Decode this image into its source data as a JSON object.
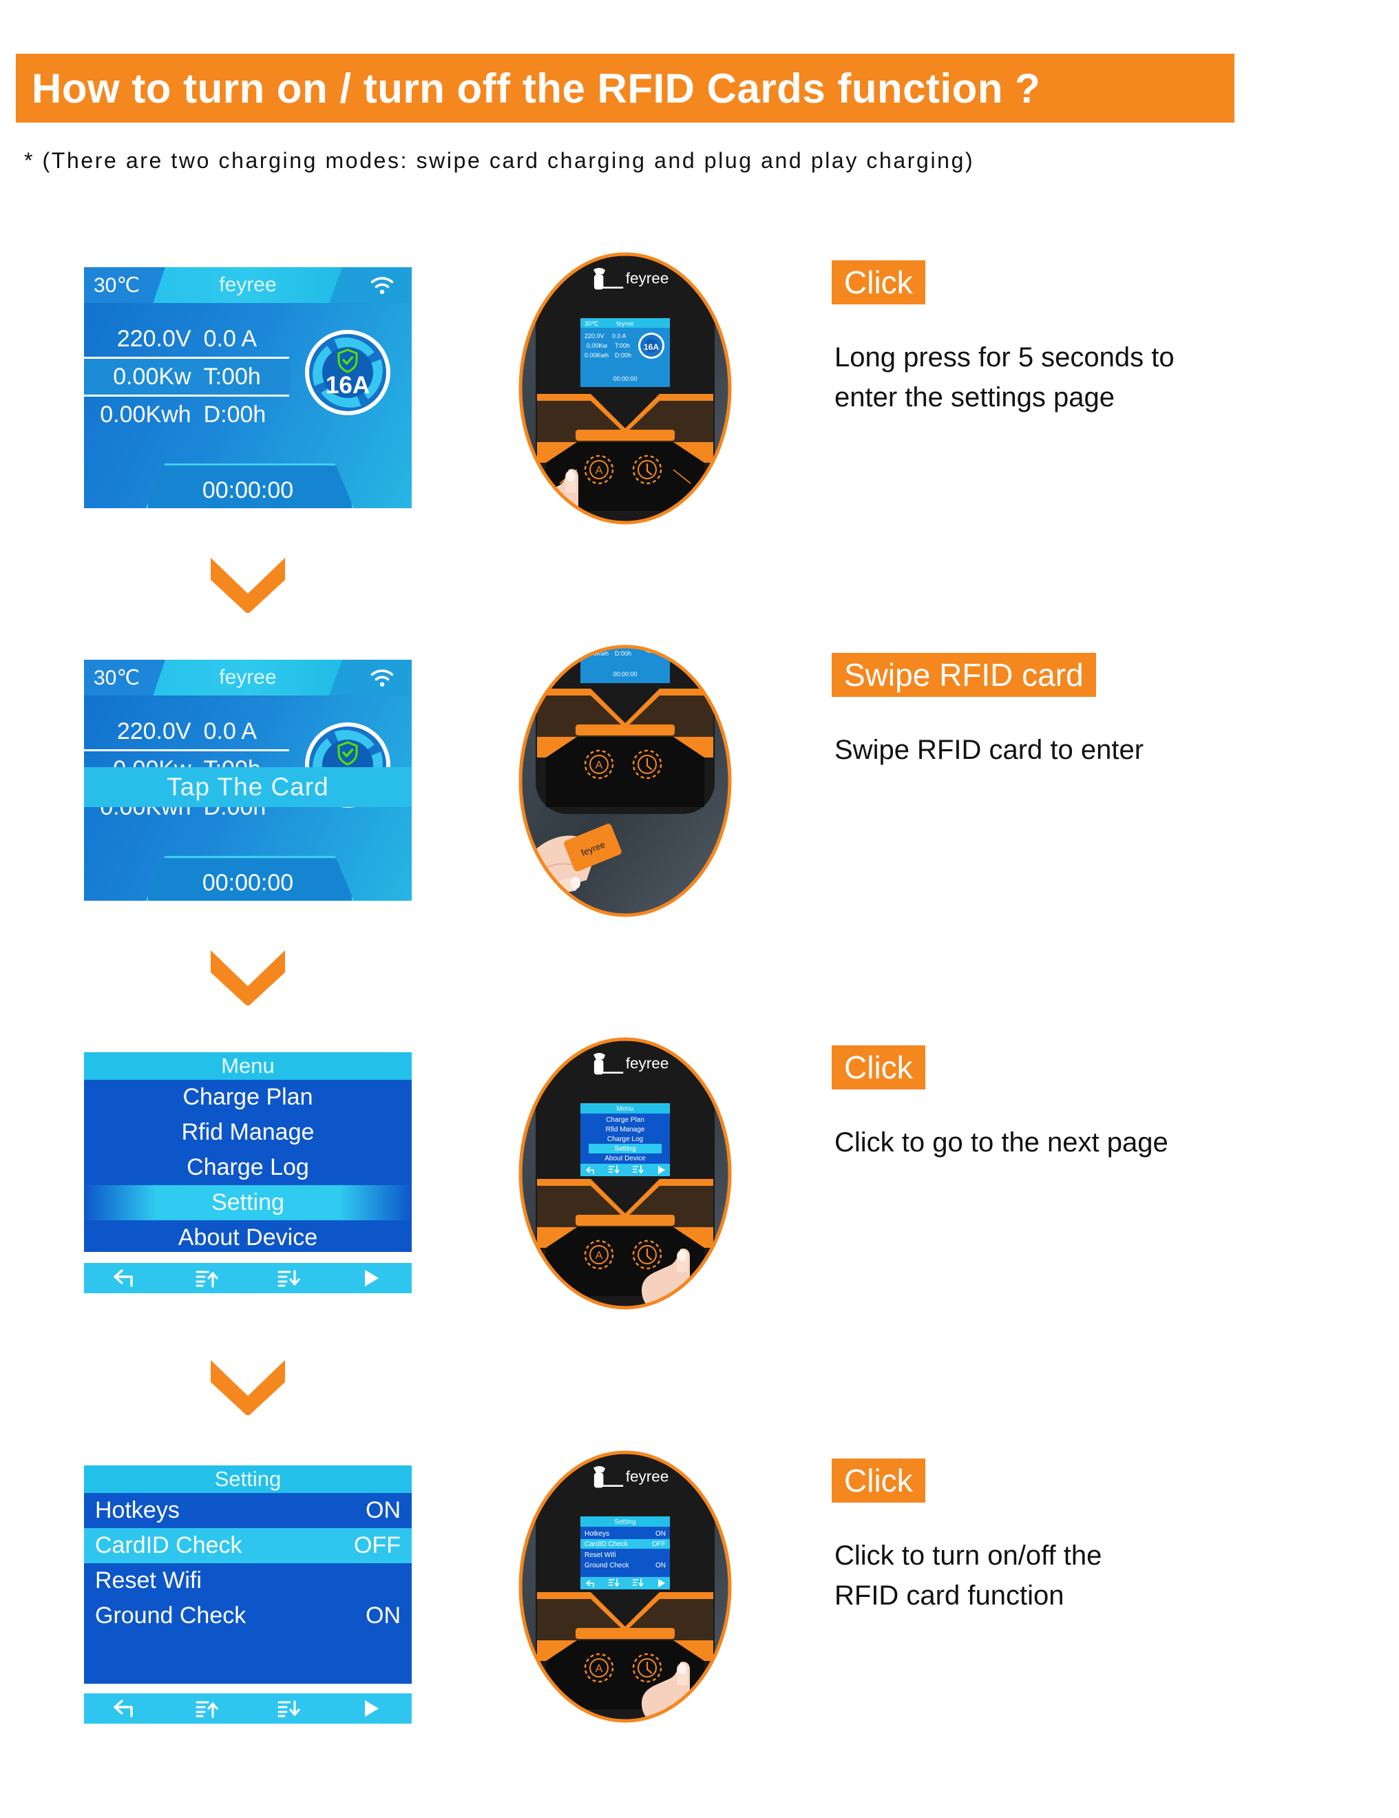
{
  "header": {
    "title": "How to turn on / turn off the RFID Cards function ?",
    "subtitle": "* (There are two charging modes: swipe card charging and plug and play charging)",
    "accent_color": "#F5871F"
  },
  "brand": "feyree",
  "status_screen": {
    "temperature": "30℃",
    "brand": "feyree",
    "wifi_icon": "wifi-icon",
    "rows": [
      {
        "left": "220.0V",
        "right": "0.0 A"
      },
      {
        "left": "0.00Kw",
        "right": "T:00h"
      },
      {
        "left": "0.00Kwh",
        "right": "D:00h"
      }
    ],
    "gauge_value": "16A",
    "shield_icon": "shield-check-icon",
    "timer": "00:00:00",
    "overlay_banner": "Tap The Card"
  },
  "menu_screen": {
    "title": "Menu",
    "items": [
      {
        "label": "Charge Plan",
        "selected": false
      },
      {
        "label": "Rfid Manage",
        "selected": false
      },
      {
        "label": "Charge Log",
        "selected": false
      },
      {
        "label": "Setting",
        "selected": true
      },
      {
        "label": "About Device",
        "selected": false
      }
    ],
    "toolbar": [
      "back-icon",
      "scroll-up-icon",
      "scroll-down-icon",
      "select-arrow-icon"
    ]
  },
  "setting_screen": {
    "title": "Setting",
    "items": [
      {
        "label": "Hotkeys",
        "value": "ON",
        "selected": false
      },
      {
        "label": "CardID Check",
        "value": "OFF",
        "selected": true
      },
      {
        "label": "Reset Wifi",
        "value": "",
        "selected": false
      },
      {
        "label": "Ground Check",
        "value": "ON",
        "selected": false
      }
    ],
    "toolbar": [
      "back-icon",
      "scroll-up-icon",
      "scroll-down-icon",
      "select-arrow-icon"
    ]
  },
  "steps": [
    {
      "tag": "Click",
      "caption": "Long press for 5 seconds to\nenter the settings page"
    },
    {
      "tag": "Swipe RFID card",
      "caption": "Swipe RFID card to enter"
    },
    {
      "tag": "Click",
      "caption": "Click to go to the next page"
    },
    {
      "tag": "Click",
      "caption": "Click to turn on/off the\nRFID card function"
    }
  ],
  "device": {
    "logo_text": "feyree",
    "button_a_icon": "auto-mode-button-icon",
    "button_clock_icon": "timer-power-button-icon",
    "rfid_card_label": "feyree"
  },
  "arrow_icon": "chevron-down-icon"
}
